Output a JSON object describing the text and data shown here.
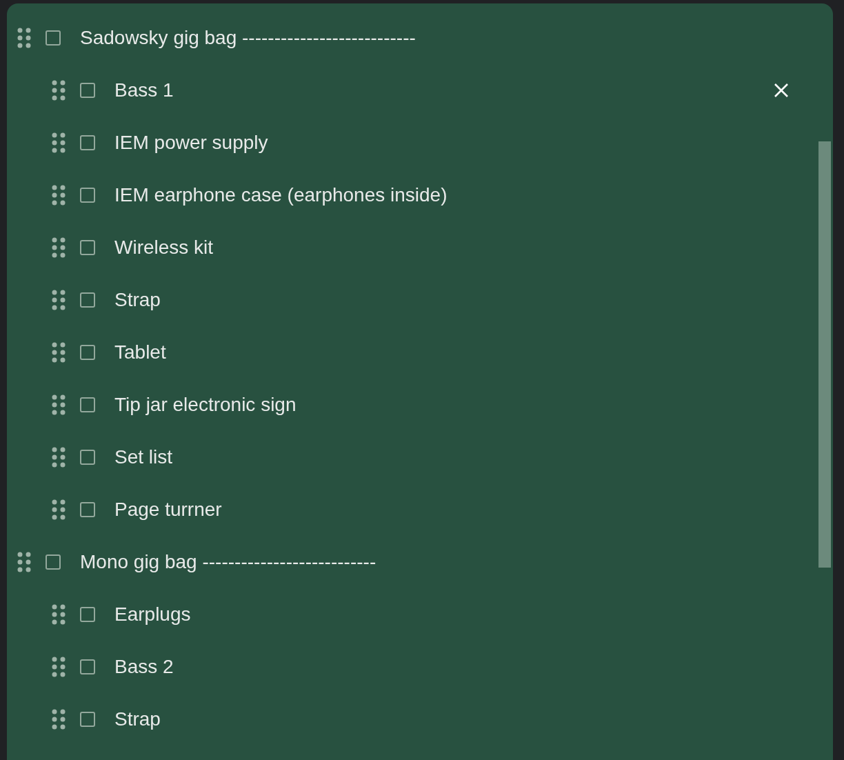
{
  "groups": [
    {
      "text": "Sadowsky gig bag ---------------------------",
      "checked": false,
      "children": [
        {
          "text": "Bass 1",
          "checked": false,
          "delete_visible": true
        },
        {
          "text": "IEM power supply",
          "checked": false,
          "delete_visible": false
        },
        {
          "text": "IEM earphone case (earphones inside)",
          "checked": false,
          "delete_visible": false
        },
        {
          "text": "Wireless kit",
          "checked": false,
          "delete_visible": false
        },
        {
          "text": "Strap",
          "checked": false,
          "delete_visible": false
        },
        {
          "text": "Tablet",
          "checked": false,
          "delete_visible": false
        },
        {
          "text": "Tip jar electronic sign",
          "checked": false,
          "delete_visible": false
        },
        {
          "text": "Set list",
          "checked": false,
          "delete_visible": false
        },
        {
          "text": "Page turrner",
          "checked": false,
          "delete_visible": false
        }
      ]
    },
    {
      "text": "Mono gig bag ---------------------------",
      "checked": false,
      "children": [
        {
          "text": "Earplugs",
          "checked": false,
          "delete_visible": false
        },
        {
          "text": "Bass 2",
          "checked": false,
          "delete_visible": false
        },
        {
          "text": "Strap",
          "checked": false,
          "delete_visible": false
        }
      ]
    }
  ]
}
